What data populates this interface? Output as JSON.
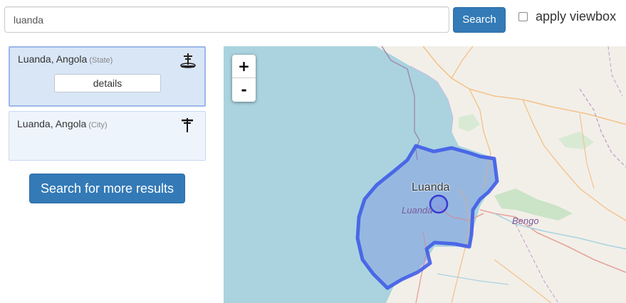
{
  "search": {
    "value": "luanda",
    "button_label": "Search",
    "viewbox_label": "apply viewbox",
    "viewbox_checked": false
  },
  "results": [
    {
      "name": "Luanda, Angola",
      "type": "(State)",
      "icon": "state-icon",
      "details_label": "details",
      "selected": true
    },
    {
      "name": "Luanda, Angola",
      "type": "(City)",
      "icon": "city-icon",
      "selected": false
    }
  ],
  "more_results_label": "Search for more results",
  "map": {
    "zoom_in_label": "+",
    "zoom_out_label": "-",
    "labels": {
      "city": "Luanda",
      "city_italic": "Luanda",
      "region": "Bengo"
    },
    "colors": {
      "water": "#aad3df",
      "land": "#f2efe9",
      "highlight": "#3a56e8"
    }
  }
}
